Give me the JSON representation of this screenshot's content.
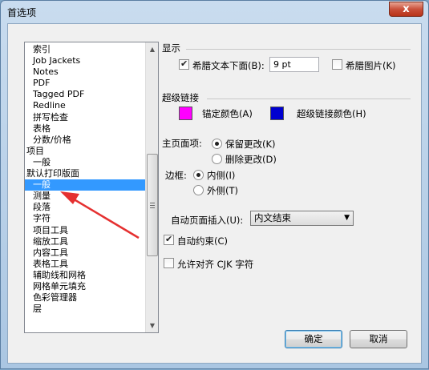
{
  "window": {
    "title": "首选项",
    "close_label": "x"
  },
  "list": {
    "items": [
      {
        "label": "索引",
        "level": 1
      },
      {
        "label": "Job Jackets",
        "level": 1
      },
      {
        "label": "Notes",
        "level": 1
      },
      {
        "label": "PDF",
        "level": 1
      },
      {
        "label": "Tagged PDF",
        "level": 1
      },
      {
        "label": "Redline",
        "level": 1
      },
      {
        "label": "拼写检查",
        "level": 1
      },
      {
        "label": "表格",
        "level": 1
      },
      {
        "label": "分数/价格",
        "level": 1
      },
      {
        "label": "项目",
        "level": 0
      },
      {
        "label": "一般",
        "level": 1
      },
      {
        "label": "默认打印版面",
        "level": 0
      },
      {
        "label": "一般",
        "level": 1,
        "selected": true
      },
      {
        "label": "测量",
        "level": 1
      },
      {
        "label": "段落",
        "level": 1
      },
      {
        "label": "字符",
        "level": 1
      },
      {
        "label": "项目工具",
        "level": 1
      },
      {
        "label": "缩放工具",
        "level": 1
      },
      {
        "label": "内容工具",
        "level": 1
      },
      {
        "label": "表格工具",
        "level": 1
      },
      {
        "label": "辅助线和网格",
        "level": 1
      },
      {
        "label": "网格单元填充",
        "level": 1
      },
      {
        "label": "色彩管理器",
        "level": 1
      },
      {
        "label": "层",
        "level": 1
      }
    ]
  },
  "display": {
    "section_label": "显示",
    "greek_text_label": "希腊文本下面(B):",
    "greek_text_checked": true,
    "greek_text_value": "9 pt",
    "greek_pictures_label": "希腊图片(K)",
    "greek_pictures_checked": false
  },
  "hyperlinks": {
    "section_label": "超级链接",
    "anchor_color_label": "锚定颜色(A)",
    "anchor_color": "#ff00ff",
    "hyperlink_color_label": "超级链接颜色(H)",
    "hyperlink_color": "#0000d0"
  },
  "master_page": {
    "label": "主页面项:",
    "keep_changes": "保留更改(K)",
    "delete_changes": "删除更改(D)",
    "keep_selected": true
  },
  "margins": {
    "label": "边框:",
    "inside": "内侧(I)",
    "outside": "外侧(T)",
    "inside_selected": true
  },
  "auto_page_insert": {
    "label": "自动页面插入(U):",
    "value": "内文结束"
  },
  "auto_constrain": {
    "label": "自动约束(C)",
    "checked": true
  },
  "cjk": {
    "label": "允许对齐 CJK 字符",
    "checked": false
  },
  "buttons": {
    "ok": "确定",
    "cancel": "取消"
  }
}
